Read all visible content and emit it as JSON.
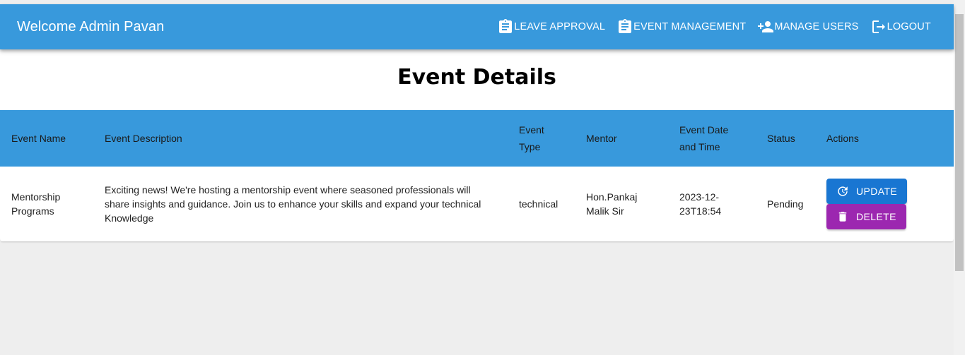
{
  "header": {
    "welcome": "Welcome Admin Pavan",
    "nav": [
      {
        "label": "LEAVE APPROVAL",
        "icon": "clipboard-icon"
      },
      {
        "label": "EVENT MANAGEMENT",
        "icon": "clipboard-icon"
      },
      {
        "label": "MANAGE USERS",
        "icon": "person-add-icon"
      },
      {
        "label": "LOGOUT",
        "icon": "logout-icon"
      }
    ]
  },
  "page": {
    "title": "Event Details"
  },
  "table": {
    "columns": [
      "Event Name",
      "Event Description",
      "Event Type",
      "Mentor",
      "Event Date and Time",
      "Status",
      "Actions"
    ],
    "rows": [
      {
        "name": "Mentorship Programs",
        "description": "Exciting news! We're hosting a mentorship event where seasoned professionals will share insights and guidance. Join us to enhance your skills and expand your technical Knowledge",
        "type": "technical",
        "mentor": "Hon.Pankaj Malik Sir",
        "datetime": "2023-12-23T18:54",
        "status": "Pending",
        "actions": {
          "update": "UPDATE",
          "delete": "DELETE"
        }
      }
    ]
  },
  "colors": {
    "primary": "#3899dc",
    "update": "#1976d2",
    "delete": "#9c27b0"
  }
}
